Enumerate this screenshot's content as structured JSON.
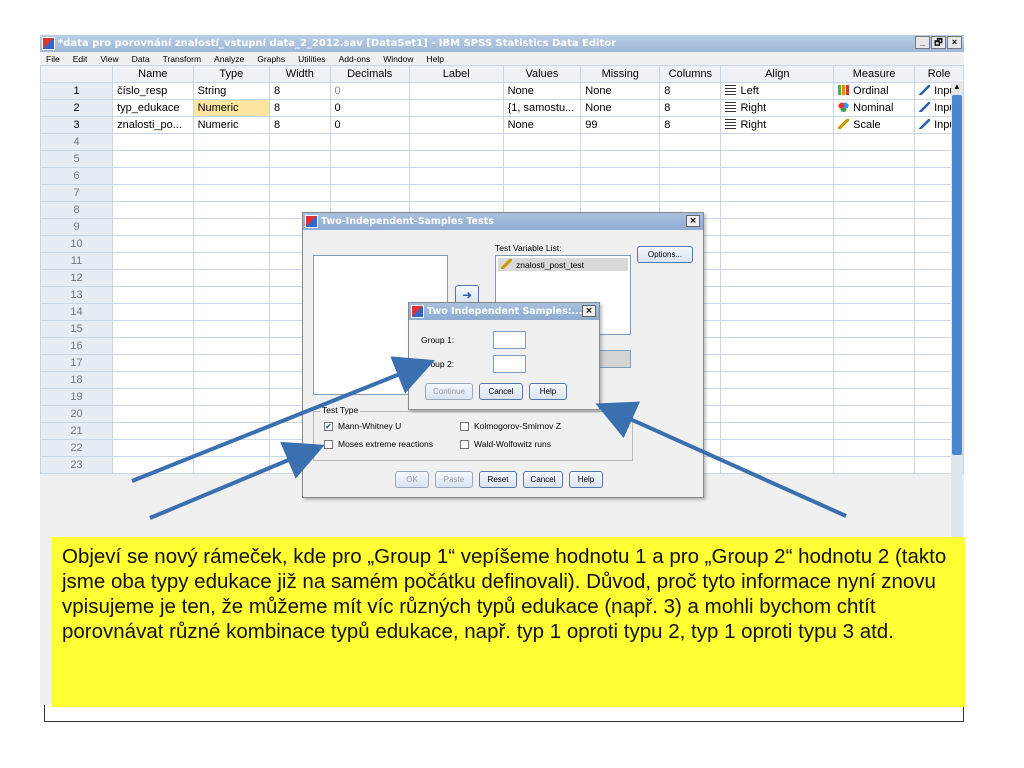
{
  "window": {
    "title": "*data pro porovnání znalostí_vstupní data_2_2012.sav [DataSet1] - IBM SPSS Statistics Data Editor",
    "controls": [
      "_",
      "🗗",
      "×"
    ]
  },
  "menu": [
    "File",
    "Edit",
    "View",
    "Data",
    "Transform",
    "Analyze",
    "Graphs",
    "Utilities",
    "Add-ons",
    "Window",
    "Help"
  ],
  "grid": {
    "columns": [
      "Name",
      "Type",
      "Width",
      "Decimals",
      "Label",
      "Values",
      "Missing",
      "Columns",
      "Align",
      "Measure",
      "Role"
    ],
    "rows": [
      {
        "n": "1",
        "name": "číslo_resp",
        "type": "String",
        "width": "8",
        "decimals": "0",
        "label": "",
        "values": "None",
        "missing": "None",
        "columns": "8",
        "align": "Left",
        "measure": "Ordinal",
        "role": "Input"
      },
      {
        "n": "2",
        "name": "typ_edukace",
        "type": "Numeric",
        "width": "8",
        "decimals": "0",
        "label": "",
        "values": "{1, samostu...",
        "missing": "None",
        "columns": "8",
        "align": "Right",
        "measure": "Nominal",
        "role": "Input"
      },
      {
        "n": "3",
        "name": "znalosti_po...",
        "type": "Numeric",
        "width": "8",
        "decimals": "0",
        "label": "",
        "values": "None",
        "missing": "99",
        "columns": "8",
        "align": "Right",
        "measure": "Scale",
        "role": "Input"
      }
    ],
    "empty_rows": [
      "4",
      "5",
      "6",
      "7",
      "8",
      "9",
      "10",
      "11",
      "12",
      "13",
      "14",
      "15",
      "16",
      "17",
      "18",
      "19",
      "20",
      "21",
      "22",
      "23"
    ]
  },
  "dialog_tests": {
    "title": "Two-Independent-Samples Tests",
    "test_variable_list_label": "Test Variable List:",
    "test_variable": "znalosti_post_test",
    "options_button": "Options...",
    "test_type_label": "Test Type",
    "tests": [
      {
        "label": "Mann-Whitney U",
        "checked": true
      },
      {
        "label": "Kolmogorov-Smirnov Z",
        "checked": false
      },
      {
        "label": "Moses extreme reactions",
        "checked": false
      },
      {
        "label": "Wald-Wolfowitz runs",
        "checked": false
      }
    ],
    "buttons": [
      "OK",
      "Paste",
      "Reset",
      "Cancel",
      "Help"
    ]
  },
  "dialog_groups": {
    "title": "Two Independent Samples:...",
    "group1_label": "Group 1:",
    "group2_label": "Group 2:",
    "group1_value": "",
    "group2_value": "",
    "buttons": [
      "Continue",
      "Cancel",
      "Help"
    ]
  },
  "caption": {
    "text": "Objeví se nový rámeček, kde pro „Group 1“ vepíšeme hodnotu 1 a pro „Group 2“ hodnotu 2 (takto jsme oba typy edukace již na samém počátku definovali). Důvod, proč tyto informace nyní znovu vpisujeme je ten, že můžeme mít víc různých typů edukace (např. 3) a mohli bychom chtít porovnávat různé kombinace typů edukace, např. typ 1 oproti typu 2, typ 1 oproti typu 3 atd."
  },
  "colors": {
    "caption_bg": "#ffff33",
    "arrow": "#3a6fb0",
    "selected_cell": "#fde7a0"
  }
}
